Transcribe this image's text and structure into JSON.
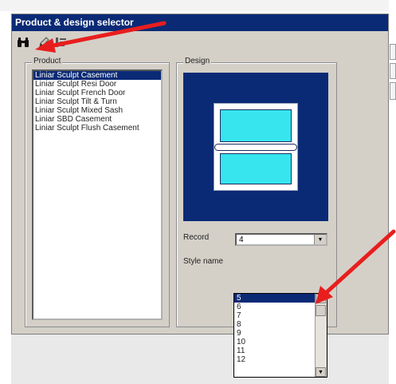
{
  "window": {
    "title": "Product & design selector"
  },
  "toolbar": {
    "icons": [
      "binoculars-icon",
      "pencil-icon",
      "list-icon"
    ]
  },
  "product": {
    "group_label": "Product",
    "items": [
      "Liniar Sculpt Casement",
      "Liniar Sculpt Resi Door",
      "Liniar Sculpt French Door",
      "Liniar Sculpt Tilt & Turn",
      "Liniar Sculpt Mixed Sash",
      "Liniar SBD Casement",
      "Liniar Sculpt Flush Casement"
    ],
    "selected_index": 0
  },
  "design": {
    "group_label": "Design",
    "record_label": "Record",
    "record_value": "4",
    "style_name_label": "Style name",
    "record_options": [
      "5",
      "6",
      "7",
      "8",
      "9",
      "10",
      "11",
      "12"
    ],
    "highlighted_option": "5"
  },
  "colors": {
    "titlebar": "#0a2a76",
    "selection": "#0a2a76",
    "design_background": "#0a2a76",
    "glass": "#37e5ee",
    "annotation_arrow": "#e81e1e"
  }
}
